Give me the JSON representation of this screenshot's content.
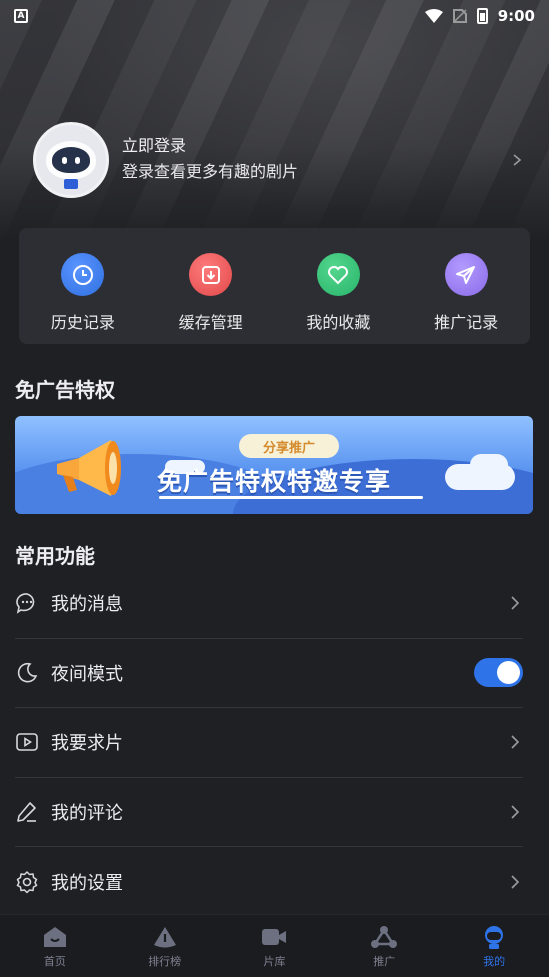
{
  "status_bar": {
    "time": "9:00"
  },
  "profile": {
    "login_label": "立即登录",
    "subtitle": "登录查看更多有趣的剧片"
  },
  "quick_actions": [
    {
      "label": "历史记录",
      "icon": "history-icon",
      "color": "#2f6fe0"
    },
    {
      "label": "缓存管理",
      "icon": "download-icon",
      "color": "#e0484a"
    },
    {
      "label": "我的收藏",
      "icon": "heart-icon",
      "color": "#27b46a"
    },
    {
      "label": "推广记录",
      "icon": "send-icon",
      "color": "#8a6ae8"
    }
  ],
  "ad_free": {
    "title": "免广告特权",
    "banner_tag": "分享推广",
    "banner_headline": "免广告特权特邀专享"
  },
  "common": {
    "title": "常用功能",
    "items": [
      {
        "label": "我的消息",
        "icon": "message-icon",
        "control": "chevron"
      },
      {
        "label": "夜间模式",
        "icon": "moon-icon",
        "control": "toggle",
        "toggle_on": true
      },
      {
        "label": "我要求片",
        "icon": "video-request-icon",
        "control": "chevron"
      },
      {
        "label": "我的评论",
        "icon": "pen-icon",
        "control": "chevron"
      },
      {
        "label": "我的设置",
        "icon": "settings-icon",
        "control": "chevron"
      }
    ]
  },
  "tabbar": {
    "items": [
      {
        "label": "首页",
        "icon": "home-icon",
        "active": false
      },
      {
        "label": "排行榜",
        "icon": "ranking-icon",
        "active": false
      },
      {
        "label": "片库",
        "icon": "video-library-icon",
        "active": false
      },
      {
        "label": "推广",
        "icon": "share-icon",
        "active": false
      },
      {
        "label": "我的",
        "icon": "profile-icon",
        "active": true
      }
    ]
  },
  "colors": {
    "accent": "#2f73e8",
    "background": "#1f2024",
    "card": "#2d2e33"
  }
}
